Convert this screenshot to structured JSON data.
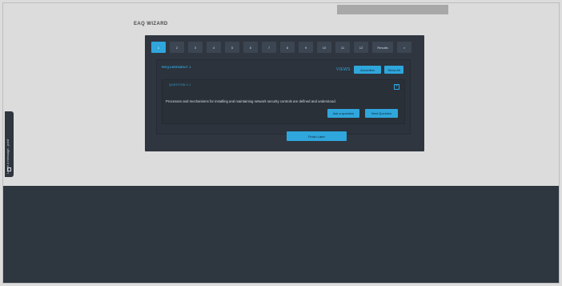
{
  "wizard": {
    "title": "EAQ WIZARD",
    "steps": [
      "1",
      "2",
      "3",
      "4",
      "5",
      "6",
      "7",
      "8",
      "9",
      "10",
      "11",
      "12",
      "Results",
      ">"
    ],
    "active_step": "1"
  },
  "requirement": {
    "title": "REQUIREMENT 1",
    "views_label": "VIEWS",
    "accordion_label": "Accordion",
    "show_all_label": "Show All"
  },
  "question": {
    "title": "QUESTION 1.1",
    "text": "Processes and mechanisms for installing and maintaining network security controls are defined and understood.",
    "ask_label": "Ask a question",
    "next_label": "Next Question"
  },
  "finish_label": "Finish Later",
  "side_tab": {
    "label": "Leave a message - pcisf"
  },
  "colors": {
    "accent": "#2fa6dc",
    "panel": "#2f3640",
    "footer": "#2e3640",
    "page_bg": "#dcdcdc"
  },
  "icons": {
    "expand": "plus-square-icon",
    "message": "chat-icon"
  }
}
